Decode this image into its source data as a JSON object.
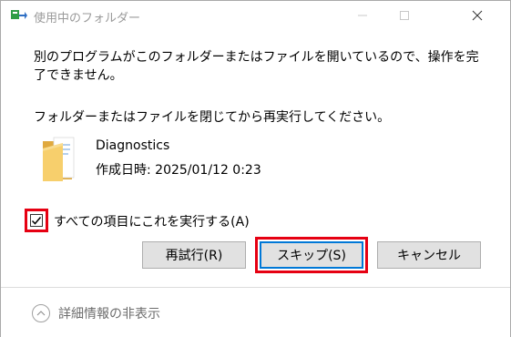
{
  "window": {
    "title": "使用中のフォルダー"
  },
  "message": {
    "line1": "別のプログラムがこのフォルダーまたはファイルを開いているので、操作を完了できません。",
    "line2": "フォルダーまたはファイルを閉じてから再実行してください。"
  },
  "file": {
    "icon": "folder-icon",
    "name": "Diagnostics",
    "created": "作成日時: 2025/01/12 0:23"
  },
  "apply_all": {
    "label": "すべての項目にこれを実行する(A)",
    "checked": true
  },
  "buttons": {
    "retry": "再試行(R)",
    "skip": "スキップ(S)",
    "cancel": "キャンセル"
  },
  "footer": {
    "details_label": "詳細情報の非表示"
  },
  "colors": {
    "highlight": "#e60012",
    "focus": "#0078d7",
    "folder": "#f4c15a"
  }
}
